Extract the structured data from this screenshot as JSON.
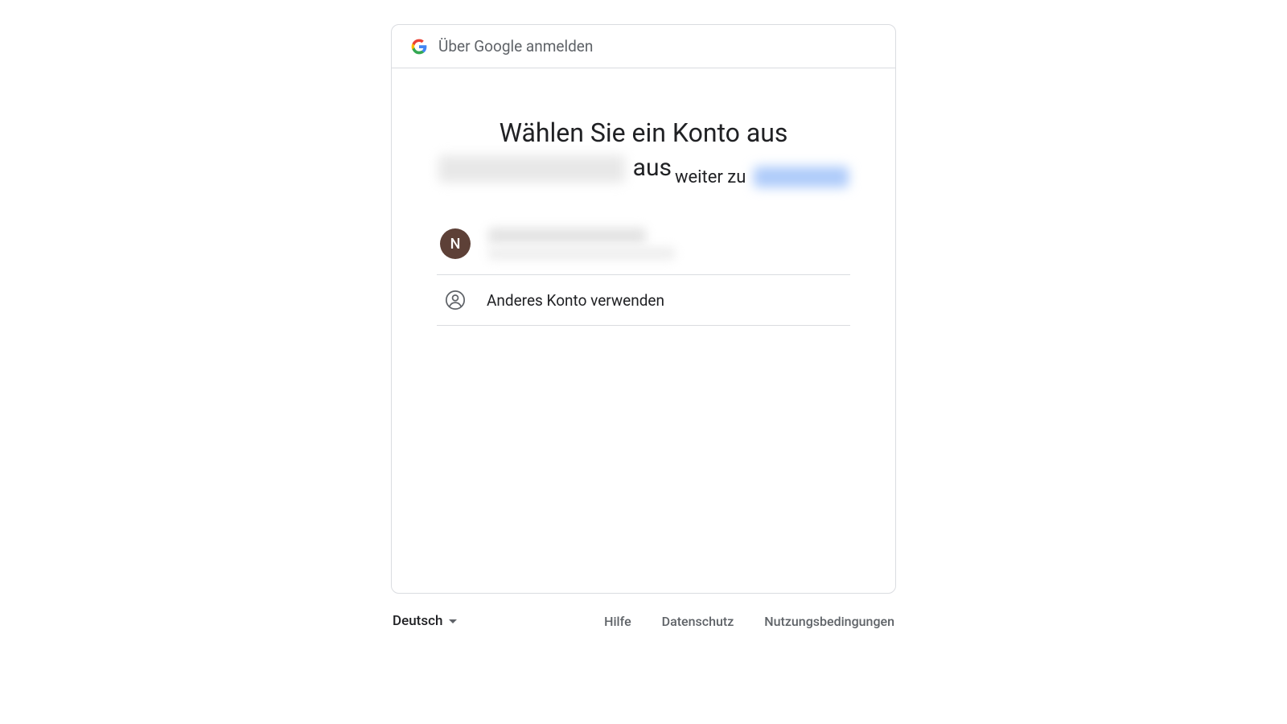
{
  "header": {
    "title": "Über Google anmelden"
  },
  "main": {
    "heading_line1": "Wählen Sie ein Konto aus",
    "heading_line2_suffix": "aus",
    "subline_prefix": "weiter zu"
  },
  "accounts": [
    {
      "avatar_initial": "N",
      "avatar_bg": "#5d4037"
    }
  ],
  "other_account_label": "Anderes Konto verwenden",
  "footer": {
    "language": "Deutsch",
    "links": {
      "help": "Hilfe",
      "privacy": "Datenschutz",
      "terms": "Nutzungsbedingungen"
    }
  }
}
